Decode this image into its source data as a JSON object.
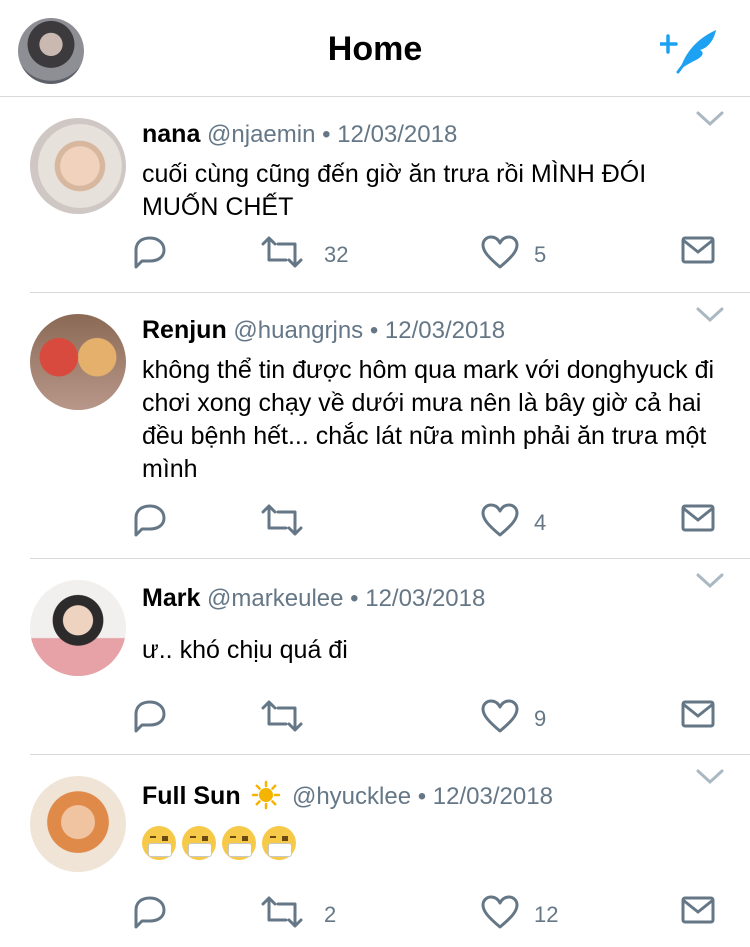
{
  "header": {
    "title": "Home"
  },
  "icons": {
    "compose": "compose-tweet-icon",
    "reply": "reply-icon",
    "retweet": "retweet-icon",
    "like": "heart-icon",
    "dm": "envelope-icon",
    "more": "chevron-down-icon"
  },
  "colors": {
    "accent": "#1da1f2",
    "muted": "#657786",
    "divider": "#d6dadd"
  },
  "tweets": [
    {
      "name": "nana",
      "handle": "@njaemin",
      "sep": "•",
      "date": "12/03/2018",
      "text": "cuối cùng cũng đến giờ ăn trưa rồi MÌNH ĐÓI MUỐN CHẾT",
      "retweets": "32",
      "likes": "5"
    },
    {
      "name": "Renjun",
      "handle": "@huangrjns",
      "sep": "•",
      "date": "12/03/2018",
      "text": "không thể tin được hôm qua mark với donghyuck đi chơi xong chạy về dưới mưa nên là bây giờ cả hai đều bệnh hết... chắc lát nữa mình phải ăn trưa một mình",
      "retweets": "",
      "likes": "4"
    },
    {
      "name": "Mark",
      "handle": "@markeulee",
      "sep": "•",
      "date": "12/03/2018",
      "text": "ư.. khó chịu quá đi",
      "retweets": "",
      "likes": "9"
    },
    {
      "name": "Full Sun",
      "handle": "@hyucklee",
      "sep": "•",
      "date": "12/03/2018",
      "text": "",
      "retweets": "2",
      "likes": "12",
      "emoji_count": 4
    }
  ]
}
